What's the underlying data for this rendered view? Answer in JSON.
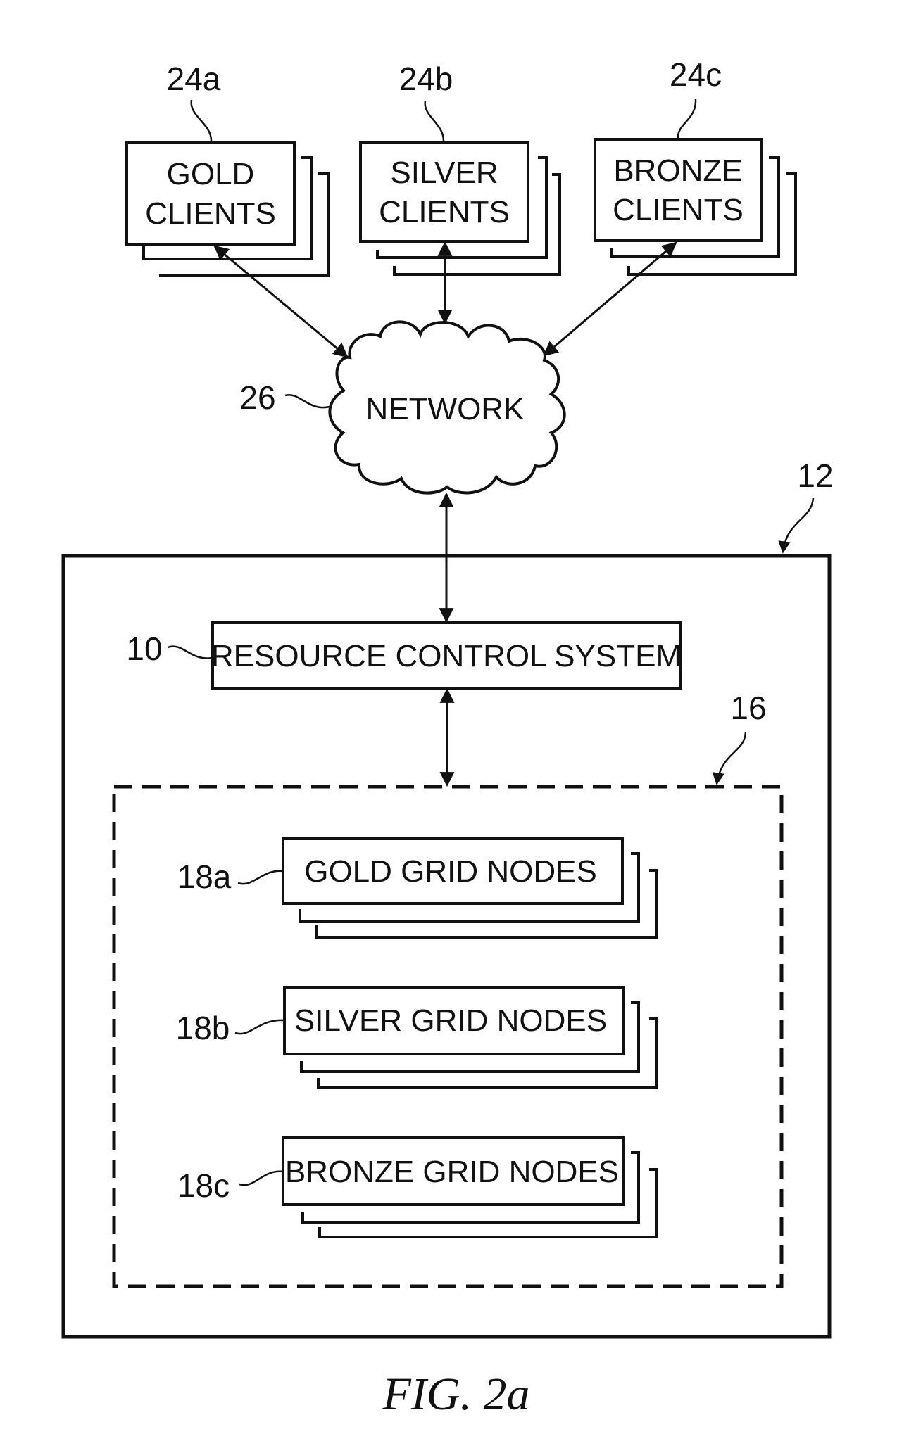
{
  "figure": {
    "caption": "FIG. 2a",
    "client_groups": [
      {
        "ref": "24a",
        "line1": "GOLD",
        "line2": "CLIENTS"
      },
      {
        "ref": "24b",
        "line1": "SILVER",
        "line2": "CLIENTS"
      },
      {
        "ref": "24c",
        "line1": "BRONZE",
        "line2": "CLIENTS"
      }
    ],
    "network": {
      "ref": "26",
      "label": "NETWORK"
    },
    "system": {
      "ref": "12"
    },
    "resource_control": {
      "ref": "10",
      "label": "RESOURCE CONTROL SYSTEM"
    },
    "grid": {
      "ref": "16"
    },
    "grid_nodes": [
      {
        "ref": "18a",
        "label": "GOLD GRID NODES"
      },
      {
        "ref": "18b",
        "label": "SILVER GRID NODES"
      },
      {
        "ref": "18c",
        "label": "BRONZE GRID NODES"
      }
    ],
    "colors": {
      "ink": "#111111",
      "paper": "#ffffff"
    }
  }
}
